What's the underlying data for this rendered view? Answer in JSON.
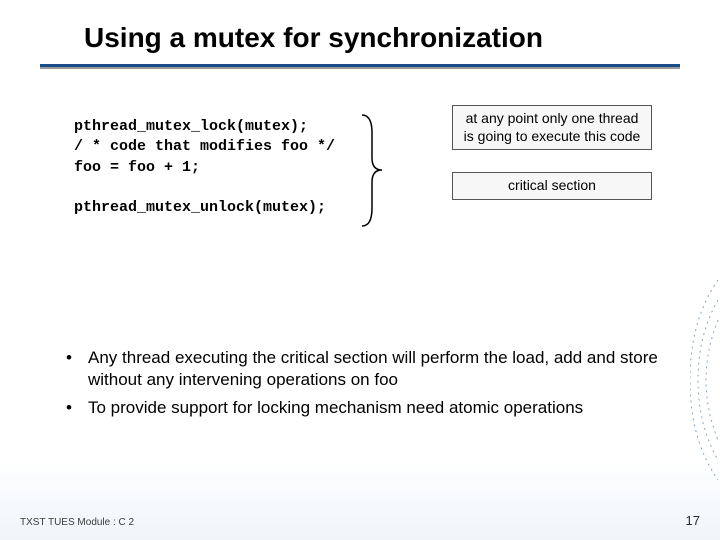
{
  "title": "Using a mutex for synchronization",
  "code": {
    "l1": "pthread_mutex_lock(mutex);",
    "l2": "/ * code that modifies foo */",
    "l3": "foo = foo + 1;",
    "l4": "",
    "l5": "pthread_mutex_unlock(mutex);"
  },
  "callouts": {
    "top": "at any point only one thread is going to execute this code",
    "bottom": "critical section"
  },
  "bullets": {
    "b1": "Any thread executing the critical section will perform the load, add and store without any intervening operations on foo",
    "b2": "To provide support for locking mechanism need atomic operations"
  },
  "footer": {
    "left": "TXST TUES Module : C 2",
    "page": "17"
  }
}
